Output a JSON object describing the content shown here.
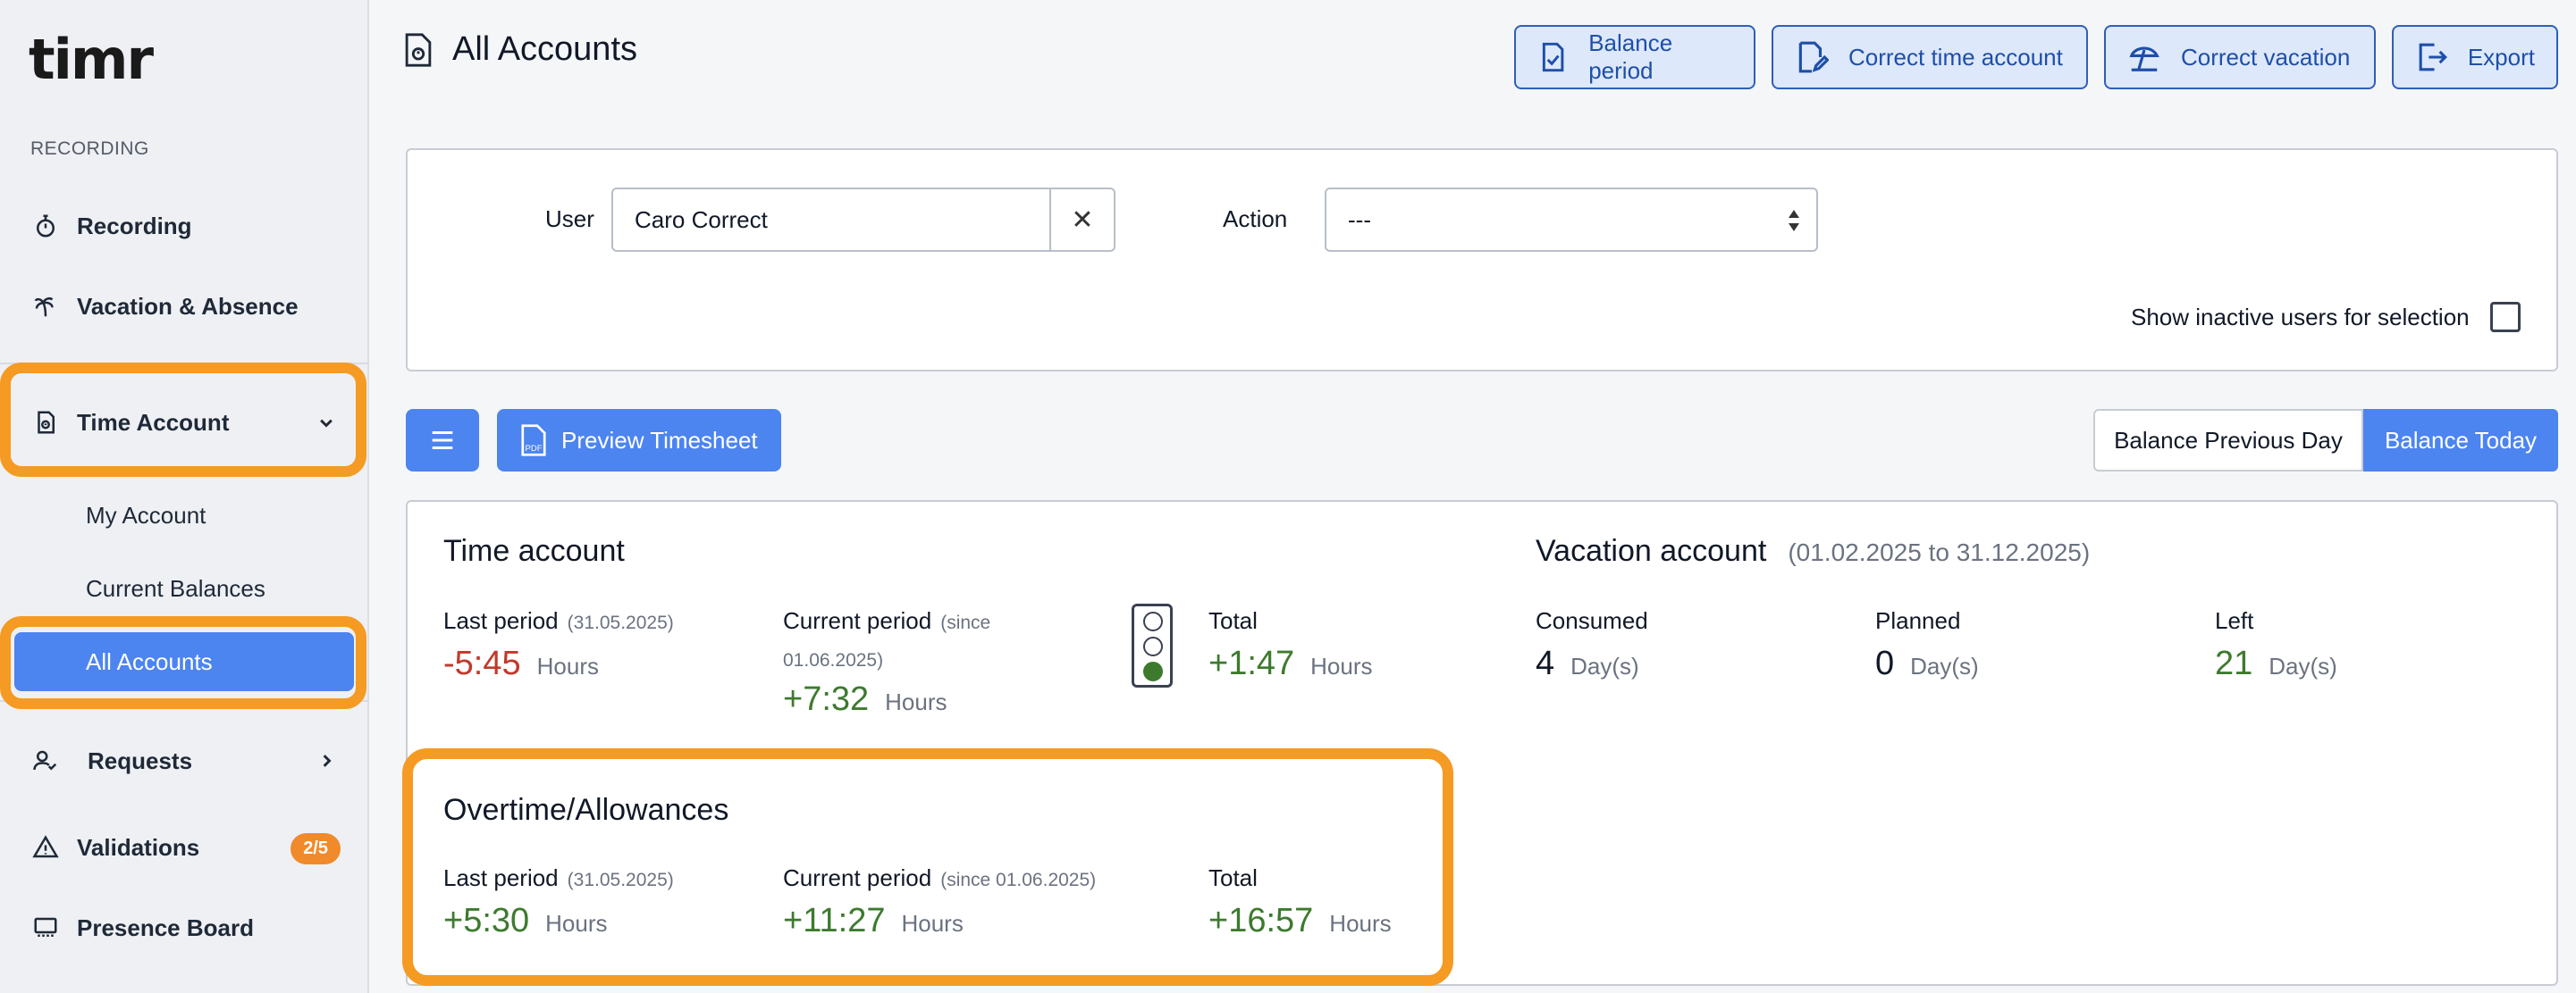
{
  "app": {
    "logo": "timr"
  },
  "sidebar": {
    "section_label": "RECORDING",
    "items": [
      {
        "label": "Recording",
        "icon": "stopwatch-icon"
      },
      {
        "label": "Vacation & Absence",
        "icon": "palm-tree-icon"
      },
      {
        "label": "Time Account",
        "icon": "document-clock-icon",
        "expanded": true
      },
      {
        "label": "Requests",
        "icon": "user-check-icon"
      },
      {
        "label": "Validations",
        "icon": "warning-icon",
        "badge": "2/5"
      },
      {
        "label": "Presence Board",
        "icon": "presence-board-icon"
      }
    ],
    "sub_items": [
      {
        "label": "My Account"
      },
      {
        "label": "Current Balances"
      },
      {
        "label": "All Accounts",
        "active": true
      }
    ]
  },
  "header": {
    "title": "All Accounts",
    "buttons": [
      {
        "label": "Balance period",
        "icon": "document-check-icon"
      },
      {
        "label": "Correct time account",
        "icon": "document-edit-icon"
      },
      {
        "label": "Correct vacation",
        "icon": "beach-umbrella-icon"
      },
      {
        "label": "Export",
        "icon": "export-icon"
      }
    ]
  },
  "filters": {
    "user_label": "User",
    "user_value": "Caro Correct",
    "clear_symbol": "✕",
    "action_label": "Action",
    "action_value": "---",
    "inactive_label": "Show inactive users for selection",
    "inactive_checked": false
  },
  "toolbar": {
    "preview_label": "Preview Timesheet",
    "balance_previous_day": "Balance Previous Day",
    "balance_today": "Balance Today"
  },
  "time_account": {
    "title": "Time account",
    "last_period_label": "Last period",
    "last_period_date": "(31.05.2025)",
    "last_period_value": "-5:45",
    "current_period_label": "Current period",
    "current_period_since_1": "(since",
    "current_period_since_2": "01.06.2025)",
    "current_period_value": "+7:32",
    "total_label": "Total",
    "total_value": "+1:47",
    "unit": "Hours",
    "status_light": "green"
  },
  "vacation_account": {
    "title": "Vacation account",
    "range": "(01.02.2025 to 31.12.2025)",
    "consumed_label": "Consumed",
    "consumed_value": "4",
    "planned_label": "Planned",
    "planned_value": "0",
    "left_label": "Left",
    "left_value": "21",
    "unit": "Day(s)"
  },
  "overtime": {
    "title": "Overtime/Allowances",
    "last_period_label": "Last period",
    "last_period_date": "(31.05.2025)",
    "last_period_value": "+5:30",
    "current_period_label": "Current period",
    "current_period_since": "(since 01.06.2025)",
    "current_period_value": "+11:27",
    "total_label": "Total",
    "total_value": "+16:57",
    "unit": "Hours"
  },
  "colors": {
    "accent": "#4c84f0",
    "highlight": "#f59a23",
    "negative": "#c0392b",
    "positive": "#3d7a2e",
    "badge": "#f08a2a"
  }
}
